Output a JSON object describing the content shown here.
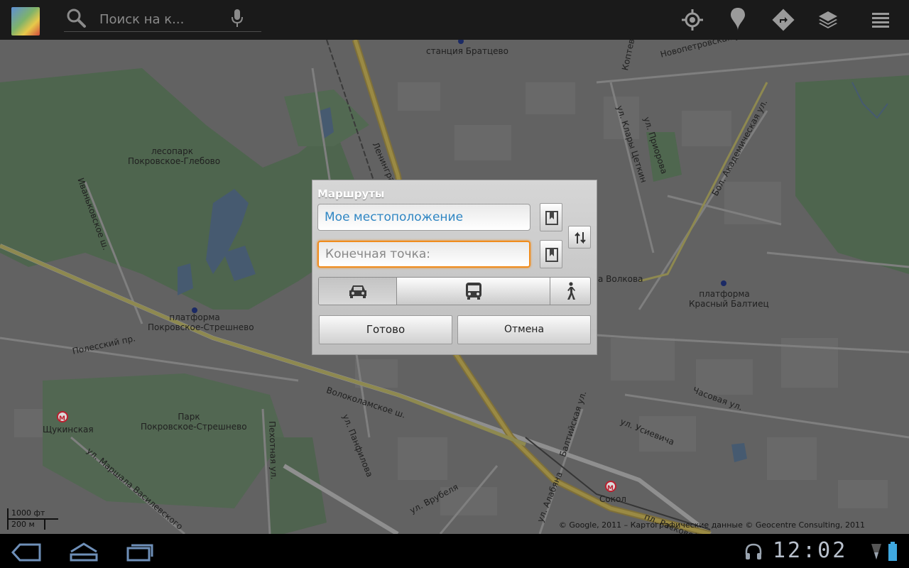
{
  "topbar": {
    "search_placeholder": "Поиск на к..."
  },
  "map": {
    "labels": {
      "station_bratcevo": "станция Братцево",
      "novopetrovskaya": "Новопетровская ул.",
      "koptevskaya": "Коптевская ул.",
      "leningradskoe": "Ленинградское",
      "klary_cetkin": "ул. Клары Цеткин",
      "priorova": "ул. Приорова",
      "akademicheskaya": "Бол. Академическая ул.",
      "lesopark_1": "лесопарк",
      "lesopark_2": "Покровское-Глебово",
      "ivankovskoe": "Иваньковское ш.",
      "volkova": "а Волкова",
      "krasny_baltiec_1": "платформа",
      "krasny_baltiec_2": "Красный Балтиец",
      "pokrovskoe_streshnevo_pl_1": "платформа",
      "pokrovskoe_streshnevo_pl_2": "Покровское-Стрешнево",
      "polessky": "Полесский пр.",
      "volokolamskoe": "Волоколамское ш.",
      "chasovaya": "Часовая ул.",
      "panfilova": "ул. Панфилова",
      "baltiyskaya": "Балтийская ул.",
      "usievicha": "ул. Усиевича",
      "shchukinskaya": "Щукинская",
      "park_1": "Парк",
      "park_2": "Покровское-Стрешнево",
      "pekhotnaya": "Пехотная ул.",
      "marshala": "ул. Маршала Василевского",
      "vrubelya": "ул. Врубеля",
      "alabyana": "ул. Алабяна",
      "sokol": "Сокол",
      "raskovoy": "пл. Расковой"
    },
    "scale_ft": "1000 фт",
    "scale_m": "200 м",
    "copyright": "© Google, 2011 – Картографические данные © Geocentre Consulting, 2011"
  },
  "dialog": {
    "title": "Маршруты",
    "start_value": "Мое местоположение",
    "end_placeholder": "Конечная точка:",
    "ok_label": "Готово",
    "cancel_label": "Отмена"
  },
  "status": {
    "time": "12:02"
  },
  "colors": {
    "accent_focus": "#f08c1c",
    "start_text": "#2f86c3"
  }
}
